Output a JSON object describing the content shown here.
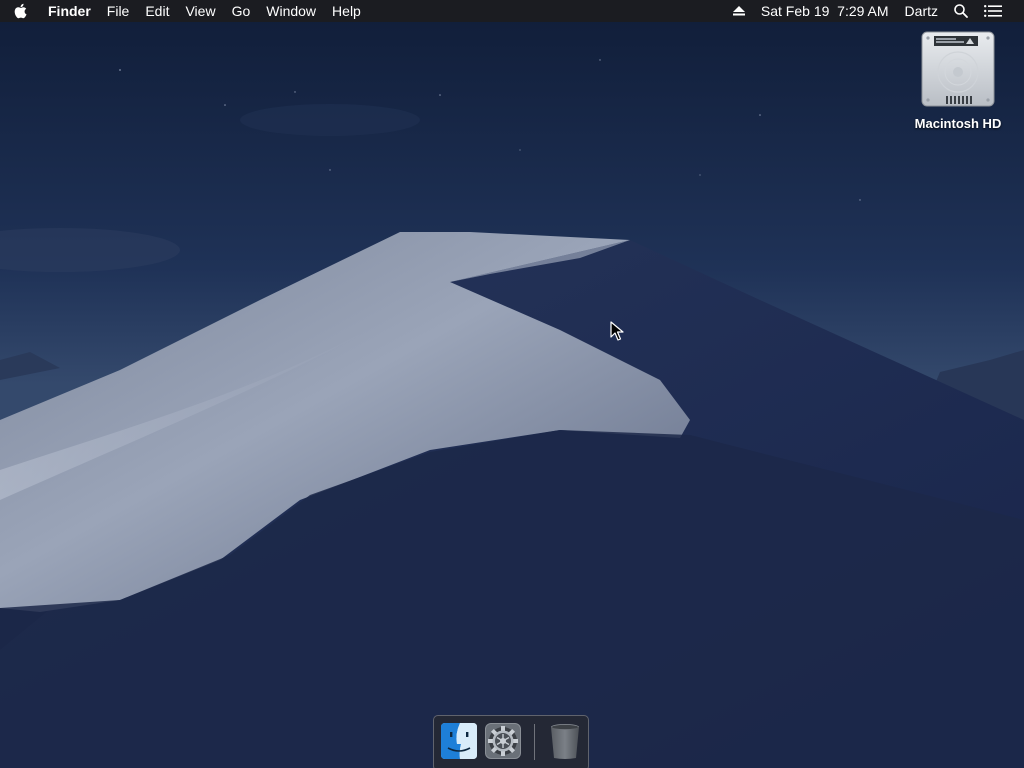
{
  "menubar": {
    "app_name": "Finder",
    "menus": [
      "File",
      "Edit",
      "View",
      "Go",
      "Window",
      "Help"
    ],
    "status": {
      "datetime": "Sat Feb 19  7:29 AM",
      "user": "Dartz"
    }
  },
  "desktop": {
    "icons": [
      {
        "label": "Macintosh HD",
        "icon": "hard-drive-icon"
      }
    ]
  },
  "dock": {
    "items": [
      {
        "name": "Finder",
        "icon": "finder-icon",
        "running": true
      },
      {
        "name": "System Preferences",
        "icon": "system-preferences-icon",
        "running": false
      },
      {
        "name": "Trash",
        "icon": "trash-icon",
        "running": false
      }
    ]
  },
  "colors": {
    "menubar_bg": "#1c1c20",
    "sky_top": "#12213f",
    "dune_light": "#aab4c8",
    "dune_dark": "#1d2a4a"
  }
}
